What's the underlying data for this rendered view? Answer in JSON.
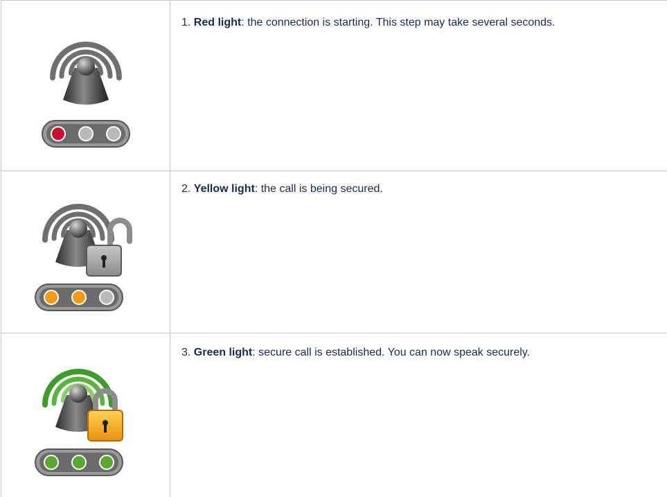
{
  "steps": [
    {
      "number": "1.",
      "title": "Red light",
      "description": ": the connection is starting. This step may take several seconds.",
      "icon": "antenna-red-light-icon",
      "lights": [
        "#c8102e",
        "#b9b9b9",
        "#b9b9b9"
      ]
    },
    {
      "number": "2.",
      "title": "Yellow light",
      "description": ": the call is being secured.",
      "icon": "antenna-unlocked-yellow-light-icon",
      "lights": [
        "#f49b1a",
        "#f49b1a",
        "#b9b9b9"
      ]
    },
    {
      "number": "3.",
      "title": "Green light",
      "description": ": secure call is established. You can now speak securely.",
      "icon": "antenna-locked-green-light-icon",
      "lights": [
        "#5aa832",
        "#5aa832",
        "#5aa832"
      ]
    }
  ],
  "colors": {
    "border": "#c1c7d0",
    "text": "#172b4d",
    "antenna_arc_gray": "#6f6f6f",
    "antenna_arc_green": "#4aa534",
    "lock_gray": "#9a9a9a",
    "lock_gold": "#f3a81b"
  }
}
